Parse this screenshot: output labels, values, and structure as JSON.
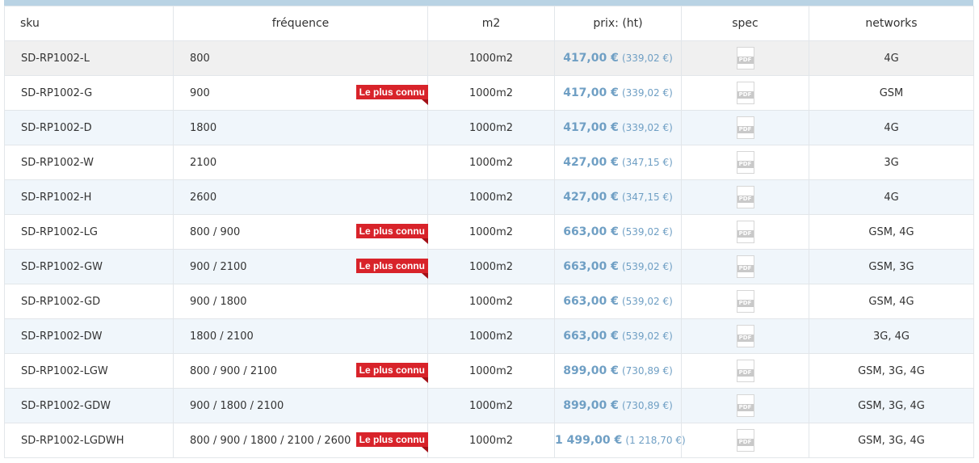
{
  "headers": {
    "sku": "sku",
    "frequence": "fréquence",
    "m2": "m2",
    "prix": "prix: (ht)",
    "spec": "spec",
    "networks": "networks"
  },
  "badge_label": "Le plus connu",
  "pdf_label": "PDF",
  "icons": {
    "spec": "pdf-icon"
  },
  "colors": {
    "badge": "#d8232a",
    "price": "#6f9fc4",
    "header_bar": "#b9d3e4",
    "row_alt": "#f0f6fb",
    "row_hover": "#f0f0f0"
  },
  "rows": [
    {
      "sku": "SD-RP1002-L",
      "freq": "800",
      "popular": false,
      "m2": "1000m2",
      "price_ttc": "417,00 €",
      "price_ht": "(339,02 €)",
      "networks": "4G",
      "state": "hover"
    },
    {
      "sku": "SD-RP1002-G",
      "freq": "900",
      "popular": true,
      "m2": "1000m2",
      "price_ttc": "417,00 €",
      "price_ht": "(339,02 €)",
      "networks": "GSM",
      "state": "plain"
    },
    {
      "sku": "SD-RP1002-D",
      "freq": "1800",
      "popular": false,
      "m2": "1000m2",
      "price_ttc": "417,00 €",
      "price_ht": "(339,02 €)",
      "networks": "4G",
      "state": "alt"
    },
    {
      "sku": "SD-RP1002-W",
      "freq": "2100",
      "popular": false,
      "m2": "1000m2",
      "price_ttc": "427,00 €",
      "price_ht": "(347,15 €)",
      "networks": "3G",
      "state": "plain"
    },
    {
      "sku": "SD-RP1002-H",
      "freq": "2600",
      "popular": false,
      "m2": "1000m2",
      "price_ttc": "427,00 €",
      "price_ht": "(347,15 €)",
      "networks": "4G",
      "state": "alt"
    },
    {
      "sku": "SD-RP1002-LG",
      "freq": "800 / 900",
      "popular": true,
      "m2": "1000m2",
      "price_ttc": "663,00 €",
      "price_ht": "(539,02 €)",
      "networks": "GSM, 4G",
      "state": "plain"
    },
    {
      "sku": "SD-RP1002-GW",
      "freq": "900 / 2100",
      "popular": true,
      "m2": "1000m2",
      "price_ttc": "663,00 €",
      "price_ht": "(539,02 €)",
      "networks": "GSM, 3G",
      "state": "alt"
    },
    {
      "sku": "SD-RP1002-GD",
      "freq": "900 / 1800",
      "popular": false,
      "m2": "1000m2",
      "price_ttc": "663,00 €",
      "price_ht": "(539,02 €)",
      "networks": "GSM, 4G",
      "state": "plain"
    },
    {
      "sku": "SD-RP1002-DW",
      "freq": "1800 / 2100",
      "popular": false,
      "m2": "1000m2",
      "price_ttc": "663,00 €",
      "price_ht": "(539,02 €)",
      "networks": "3G, 4G",
      "state": "alt"
    },
    {
      "sku": "SD-RP1002-LGW",
      "freq": "800 / 900 / 2100",
      "popular": true,
      "m2": "1000m2",
      "price_ttc": "899,00 €",
      "price_ht": "(730,89 €)",
      "networks": "GSM, 3G, 4G",
      "state": "plain"
    },
    {
      "sku": "SD-RP1002-GDW",
      "freq": "900 / 1800 / 2100",
      "popular": false,
      "m2": "1000m2",
      "price_ttc": "899,00 €",
      "price_ht": "(730,89 €)",
      "networks": "GSM, 3G, 4G",
      "state": "alt"
    },
    {
      "sku": "SD-RP1002-LGDWH",
      "freq": "800 / 900 / 1800 / 2100 / 2600",
      "popular": true,
      "m2": "1000m2",
      "price_ttc": "1 499,00 €",
      "price_ht": "(1 218,70 €)",
      "networks": "GSM, 3G, 4G",
      "state": "plain"
    }
  ]
}
